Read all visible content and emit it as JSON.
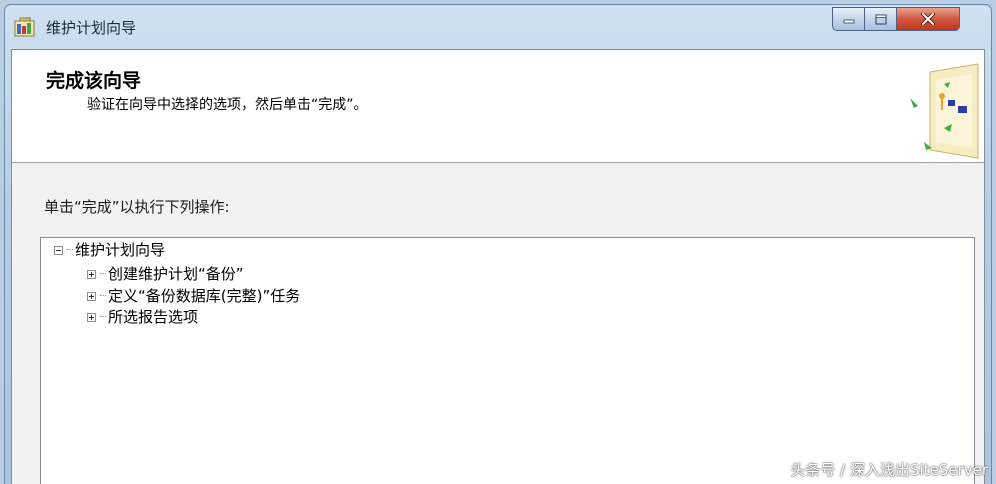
{
  "window": {
    "title": "维护计划向导",
    "controls": {
      "minimize_icon": "minimize-icon",
      "maximize_icon": "maximize-icon",
      "close_icon": "close-icon"
    }
  },
  "header": {
    "title": "完成该向导",
    "subtitle": "验证在向导中选择的选项，然后单击“完成”。"
  },
  "body": {
    "instruction": "单击“完成”以执行下列操作:",
    "tree": {
      "root": {
        "label": "维护计划向导",
        "expanded": true
      },
      "children": [
        {
          "label": "创建维护计划“备份”",
          "expanded": false
        },
        {
          "label": "定义“备份数据库(完整)”任务",
          "expanded": false
        },
        {
          "label": "所选报告选项",
          "expanded": false
        }
      ]
    }
  },
  "watermark": "头条号 / 深入浅出SiteServer",
  "colors": {
    "titlebar": "#b7cde6",
    "close_button": "#c2361c",
    "header_bg": "#ffffff",
    "body_bg": "#f2f2f2"
  }
}
